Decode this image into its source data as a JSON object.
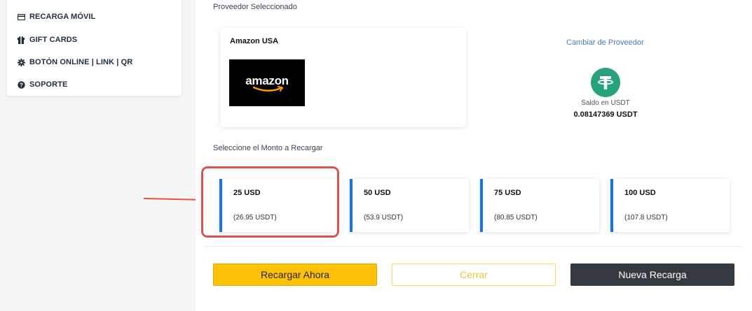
{
  "sidebar": {
    "items": [
      {
        "label": "RECARGA MÓVIL",
        "icon": "credit-card-icon"
      },
      {
        "label": "GIFT CARDS",
        "icon": "gift-icon"
      },
      {
        "label": "BOTÓN ONLINE | LINK | QR",
        "icon": "gear-icon"
      },
      {
        "label": "SOPORTE",
        "icon": "question-circle-icon"
      }
    ]
  },
  "provider": {
    "section_label": "Proveedor Seleccionado",
    "name": "Amazon USA",
    "logo_text": "amazon",
    "change_link": "Cambiar de Proveedor"
  },
  "balance": {
    "label": "Saldo en USDT",
    "value": "0.08147369 USDT",
    "icon": "tether-icon"
  },
  "amounts": {
    "section_label": "Seleccione el Monto a Recargar",
    "options": [
      {
        "usd": "25 USD",
        "usdt": "(26.95 USDT)"
      },
      {
        "usd": "50 USD",
        "usdt": "(53.9 USDT)"
      },
      {
        "usd": "75 USD",
        "usdt": "(80.85 USDT)"
      },
      {
        "usd": "100 USD",
        "usdt": "(107.8 USDT)"
      }
    ]
  },
  "buttons": {
    "recargar": "Recargar Ahora",
    "cerrar": "Cerrar",
    "nueva": "Nueva Recarga"
  },
  "colors": {
    "accent_blue": "#1a73e8",
    "highlight_red": "#d9544a",
    "primary_yellow": "#ffc107",
    "dark": "#343a40",
    "tether_green": "#26a17b"
  }
}
